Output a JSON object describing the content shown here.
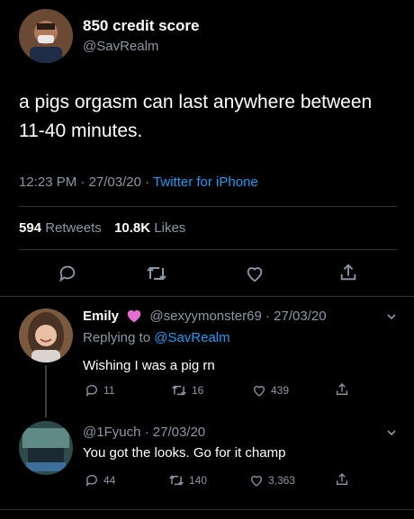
{
  "main_tweet": {
    "display_name": "850 credit score",
    "handle": "@SavRealm",
    "text": "a pigs orgasm can last anywhere between 11-40 minutes.",
    "time": "12:23 PM",
    "date": "27/03/20",
    "source": "Twitter for iPhone",
    "retweets_count": "594",
    "retweets_label": "Retweets",
    "likes_count": "10.8K",
    "likes_label": "Likes"
  },
  "reply_1": {
    "display_name": "Emily",
    "handle": "@sexyymonster69",
    "date": "27/03/20",
    "replying_to_label": "Replying to",
    "replying_to_handle": "@SavRealm",
    "text": "Wishing I was a pig rn",
    "replies": "11",
    "retweets": "16",
    "likes": "439"
  },
  "reply_2": {
    "handle": "@1Fyuch",
    "date": "27/03/20",
    "text": "You got the looks. Go for it champ",
    "replies": "44",
    "retweets": "140",
    "likes": "3,363"
  },
  "colors": {
    "background": "#000000",
    "accent": "#1d9bf0",
    "muted": "#8b98a5",
    "divider": "#2f3336",
    "heart_emoji": "#e26fcf"
  },
  "icons": [
    "reply-icon",
    "retweet-icon",
    "like-icon",
    "share-icon",
    "chevron-down-icon",
    "purple-heart-icon"
  ]
}
